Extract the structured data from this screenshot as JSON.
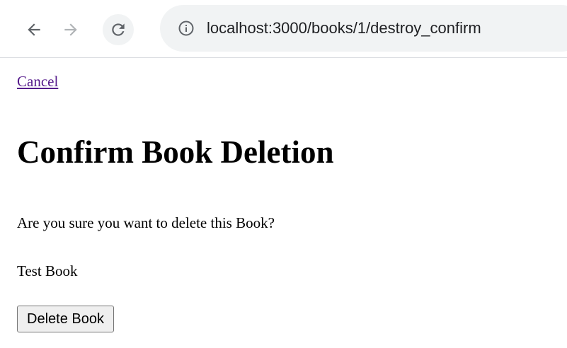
{
  "browser": {
    "url": "localhost:3000/books/1/destroy_confirm",
    "icons": {
      "back": "arrow-left-icon",
      "forward": "arrow-right-icon",
      "reload": "reload-icon",
      "site_info": "info-circle-icon"
    }
  },
  "page": {
    "cancel_label": "Cancel",
    "title": "Confirm Book Deletion",
    "confirm_question": "Are you sure you want to delete this Book?",
    "book_title": "Test Book",
    "delete_button_label": "Delete Book"
  },
  "colors": {
    "visited_link": "#551a8b",
    "toolbar_field": "#f1f3f4"
  }
}
